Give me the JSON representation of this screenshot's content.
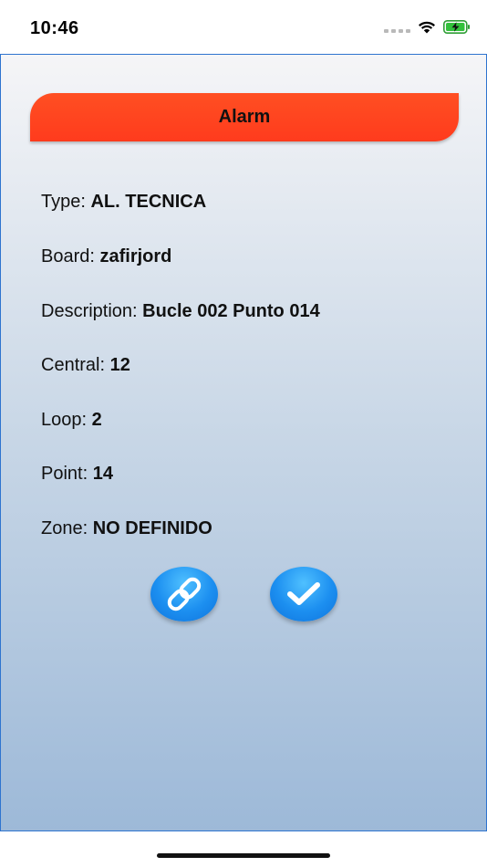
{
  "status_bar": {
    "time": "10:46"
  },
  "alarm": {
    "title": "Alarm",
    "fields": {
      "type": {
        "label": "Type:",
        "value": "AL. TECNICA"
      },
      "board": {
        "label": "Board:",
        "value": "zafirjord"
      },
      "description": {
        "label": "Description:",
        "value": "Bucle 002 Punto 014"
      },
      "central": {
        "label": "Central:",
        "value": "12"
      },
      "loop": {
        "label": "Loop:",
        "value": "2"
      },
      "point": {
        "label": "Point:",
        "value": "14"
      },
      "zone": {
        "label": "Zone:",
        "value": "NO DEFINIDO"
      }
    }
  },
  "actions": {
    "link_icon": "link-icon",
    "confirm_icon": "checkmark-icon"
  },
  "colors": {
    "header": "#ff4422",
    "button": "#1c8ff0",
    "border": "#2e74cf"
  }
}
